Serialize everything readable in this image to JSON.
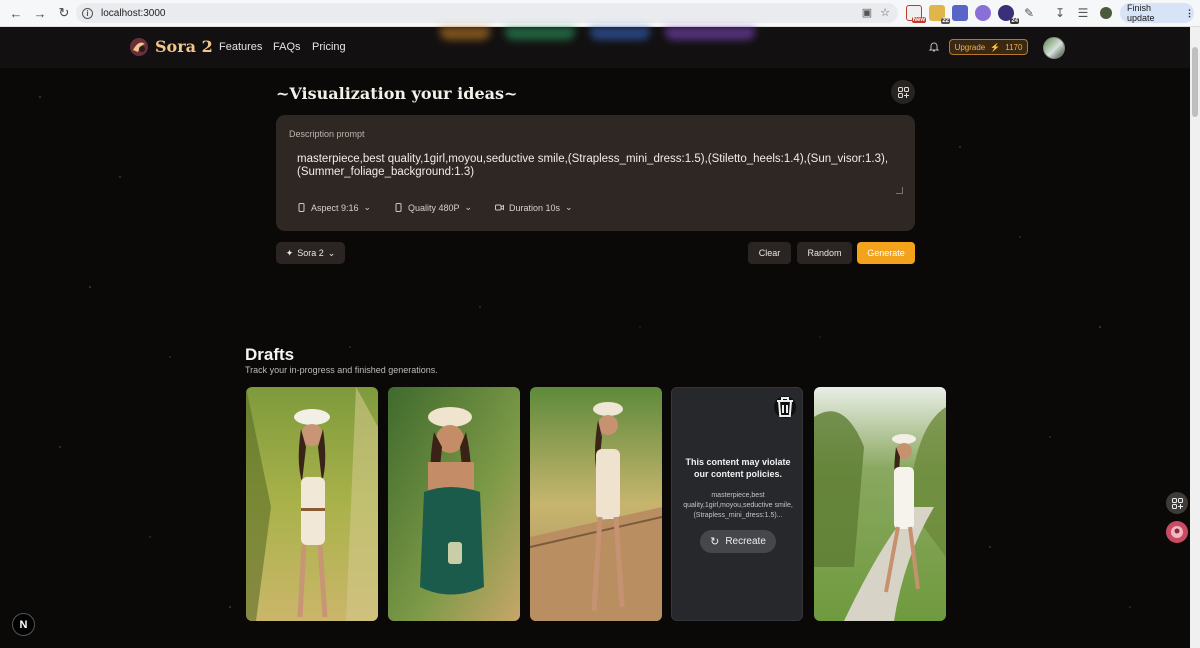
{
  "browser": {
    "url": "localhost:3000",
    "finish_update_label": "Finish update",
    "extensions": [
      {
        "name": "calendar-extension-icon",
        "badge": "New",
        "color": "#c0392b"
      },
      {
        "name": "puzzle-extension-icon",
        "badge": "22",
        "color": "#e0b64a"
      },
      {
        "name": "translate-extension-icon",
        "badge": "",
        "color": "#5865c7"
      },
      {
        "name": "shield-extension-icon",
        "badge": "",
        "color": "#8b6fd8"
      },
      {
        "name": "cloud-extension-icon",
        "badge": "24",
        "color": "#3b2f7a"
      }
    ]
  },
  "header": {
    "brand": "Sora 2",
    "nav": [
      "Features",
      "FAQs",
      "Pricing"
    ],
    "upgrade_label": "Upgrade",
    "credits": "1170"
  },
  "composer": {
    "title": "~Visualization your ideas~",
    "prompt_label": "Description prompt",
    "prompt_text": "masterpiece,best quality,1girl,moyou,seductive smile,(Strapless_mini_dress:1.5),(Stiletto_heels:1.4),(Sun_visor:1.3),(Summer_foliage_background:1.3)",
    "options": {
      "aspect": "Aspect 9:16",
      "quality": "Quality 480P",
      "duration": "Duration 10s"
    },
    "model": "Sora 2",
    "buttons": {
      "clear": "Clear",
      "random": "Random",
      "generate": "Generate"
    }
  },
  "drafts": {
    "title": "Drafts",
    "subtitle": "Track your in-progress and finished generations.",
    "blocked_message": "This content may violate our content policies.",
    "blocked_prompt": "masterpiece,best quality,1girl,moyou,seductive smile,(Strapless_mini_dress:1.5)...",
    "recreate_label": "Recreate"
  },
  "floating": {
    "n_badge": "N"
  },
  "colors": {
    "accent": "#f3a21c",
    "brand_gold": "#f2c58a",
    "card_bg": "#2e2723"
  }
}
